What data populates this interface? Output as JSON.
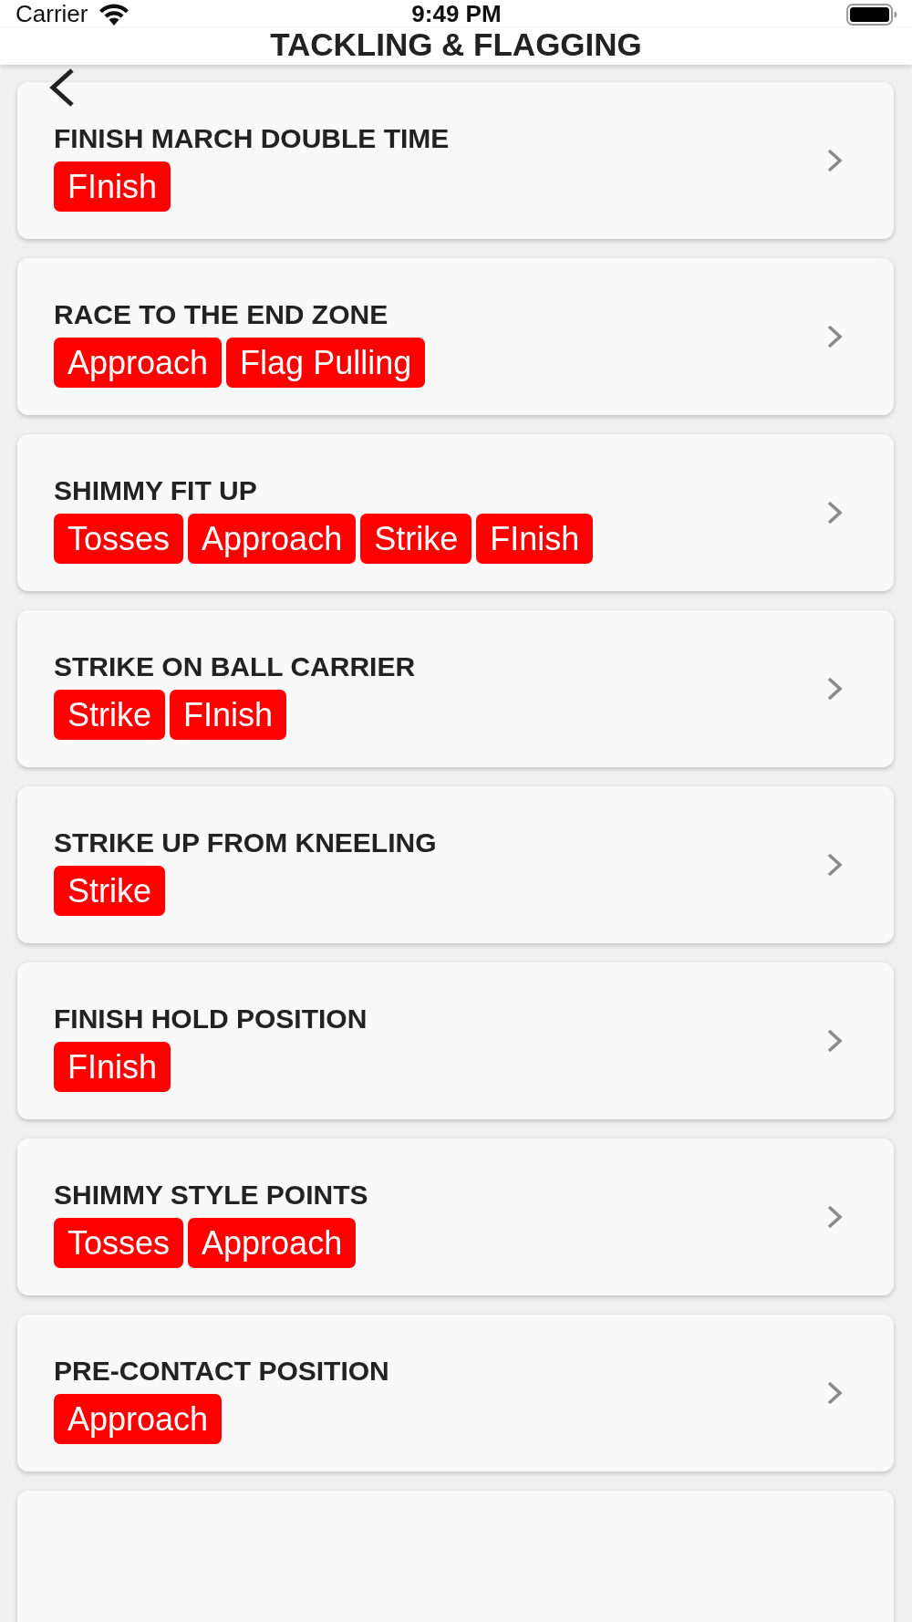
{
  "status_bar": {
    "carrier": "Carrier",
    "time": "9:49 PM"
  },
  "nav_bar": {
    "title": "TACKLING & FLAGGING"
  },
  "drills": [
    {
      "title": "FINISH MARCH DOUBLE TIME",
      "tags": [
        "FInish"
      ]
    },
    {
      "title": "RACE TO THE END ZONE",
      "tags": [
        "Approach",
        "Flag Pulling"
      ]
    },
    {
      "title": "SHIMMY FIT UP",
      "tags": [
        "Tosses",
        "Approach",
        "Strike",
        "FInish"
      ]
    },
    {
      "title": "STRIKE ON BALL CARRIER",
      "tags": [
        "Strike",
        "FInish"
      ]
    },
    {
      "title": "STRIKE UP FROM KNEELING",
      "tags": [
        "Strike"
      ]
    },
    {
      "title": "FINISH HOLD POSITION",
      "tags": [
        "FInish"
      ]
    },
    {
      "title": "SHIMMY STYLE POINTS",
      "tags": [
        "Tosses",
        "Approach"
      ]
    },
    {
      "title": "PRE-CONTACT POSITION",
      "tags": [
        "Approach"
      ]
    }
  ]
}
